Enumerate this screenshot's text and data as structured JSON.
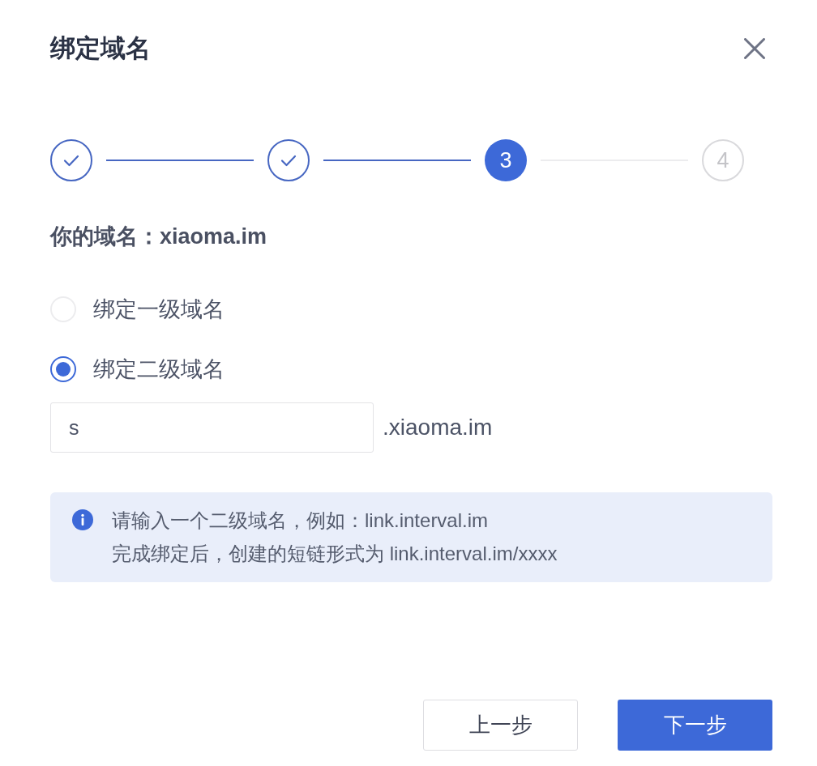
{
  "dialog": {
    "title": "绑定域名"
  },
  "steps": [
    {
      "done": true,
      "selected": false
    },
    {
      "done": true,
      "selected": false
    },
    {
      "number": "3",
      "done": false,
      "selected": true
    },
    {
      "number": "4",
      "done": false,
      "selected": false
    }
  ],
  "domain_label": "你的域名：xiaoma.im",
  "options": [
    {
      "label": "绑定一级域名",
      "selected": false
    },
    {
      "label": "绑定二级域名",
      "selected": true
    }
  ],
  "subdomain_field": {
    "value": "s",
    "suffix": ".xiaoma.im"
  },
  "notice": {
    "lines": [
      "请输入一个二级域名，例如：link.interval.im",
      "完成绑定后，创建的短链形式为 link.interval.im/xxxx"
    ]
  },
  "buttons": [
    {
      "label": "上一步",
      "kind": "outline"
    },
    {
      "label": "下一步",
      "kind": "primary"
    }
  ]
}
